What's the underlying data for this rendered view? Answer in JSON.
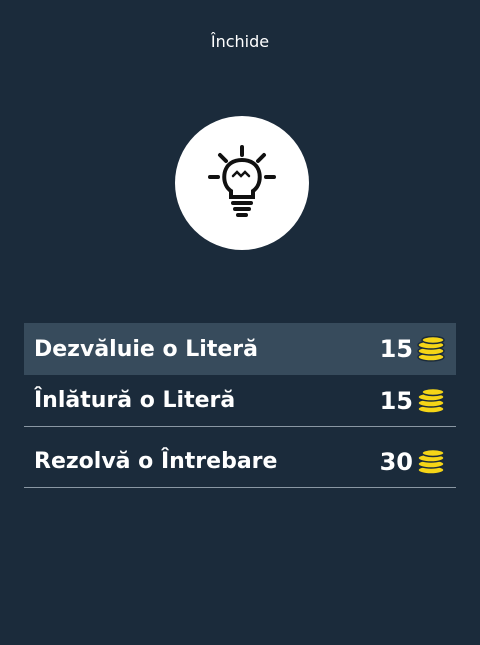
{
  "header": {
    "close_label": "Închide"
  },
  "hint": {
    "icon": "lightbulb-icon"
  },
  "options": [
    {
      "label": "Dezvăluie o Literă",
      "price": "15",
      "icon": "coins-icon"
    },
    {
      "label": "Înlătură o Literă",
      "price": "15",
      "icon": "coins-icon"
    },
    {
      "label": "Rezolvă o Întrebare",
      "price": "30",
      "icon": "coins-icon"
    }
  ],
  "colors": {
    "background": "#1b2b3b",
    "highlight": "#374b5c",
    "coin": "#f5d517",
    "separator": "#8a97a3"
  }
}
